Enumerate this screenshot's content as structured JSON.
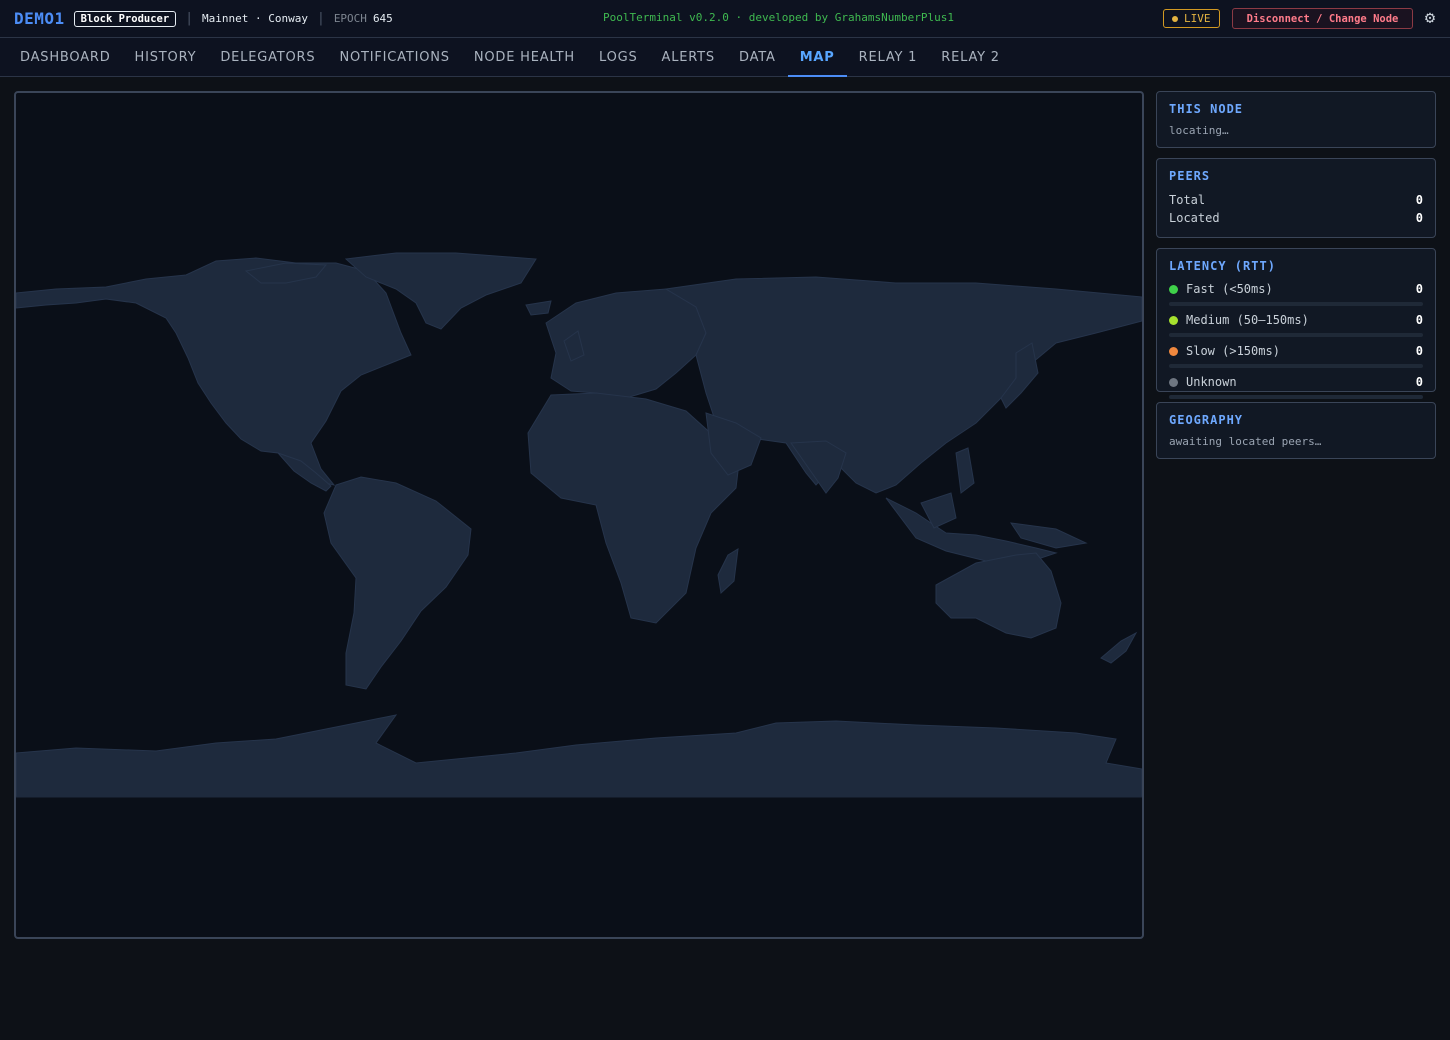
{
  "header": {
    "node_name": "DEMO1",
    "role": "Block Producer",
    "network": "Mainnet · Conway",
    "epoch_label": "EPOCH",
    "epoch_value": "645",
    "version": "PoolTerminal v0.2.0 · developed by GrahamsNumberPlus1",
    "live_label": "LIVE",
    "disconnect_label": "Disconnect / Change Node",
    "settings_icon": "gear-icon"
  },
  "nav": {
    "tabs": [
      {
        "label": "DASHBOARD"
      },
      {
        "label": "HISTORY"
      },
      {
        "label": "DELEGATORS"
      },
      {
        "label": "NOTIFICATIONS"
      },
      {
        "label": "NODE HEALTH"
      },
      {
        "label": "LOGS"
      },
      {
        "label": "ALERTS"
      },
      {
        "label": "DATA"
      },
      {
        "label": "MAP",
        "active": true
      },
      {
        "label": "RELAY 1"
      },
      {
        "label": "RELAY 2"
      }
    ]
  },
  "sidebar": {
    "this_node": {
      "title": "THIS NODE",
      "status": "locating…"
    },
    "peers": {
      "title": "PEERS",
      "total_label": "Total",
      "total_value": "0",
      "located_label": "Located",
      "located_value": "0"
    },
    "latency": {
      "title": "LATENCY (RTT)",
      "rows": [
        {
          "label": "Fast (<50ms)",
          "count": "0",
          "color": "#3fd14a",
          "fraction": 0
        },
        {
          "label": "Medium (50–150ms)",
          "count": "0",
          "color": "#a6e22e",
          "fraction": 0
        },
        {
          "label": "Slow (>150ms)",
          "count": "0",
          "color": "#f0883e",
          "fraction": 0
        },
        {
          "label": "Unknown",
          "count": "0",
          "color": "#6e7681",
          "fraction": 0
        }
      ]
    },
    "geography": {
      "title": "GEOGRAPHY",
      "status": "awaiting located peers…"
    }
  },
  "theme": {
    "accent": "#4c8df6",
    "land": "#1e2a3d",
    "ocean": "#0a0f18",
    "live": "#e3b341",
    "danger": "#ff7b8a",
    "version_text": "#3fb950"
  }
}
